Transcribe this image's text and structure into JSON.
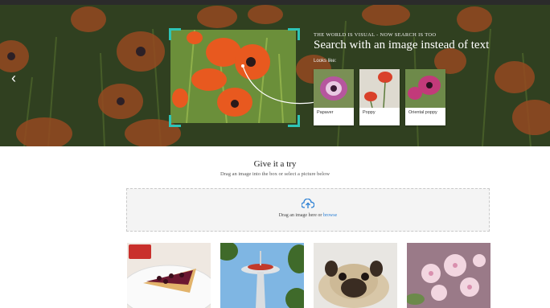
{
  "hero": {
    "eyebrow": "THE WORLD IS VISUAL - NOW SEARCH IS TOO",
    "headline": "Search with an image instead of text",
    "looks_like_label": "Looks like:",
    "results": [
      {
        "label": "Papaver"
      },
      {
        "label": "Poppy"
      },
      {
        "label": "Oriental poppy"
      }
    ],
    "prev_arrow": "‹"
  },
  "try": {
    "title": "Give it a try",
    "subtitle": "Drag an image into the box or select a picture below",
    "drop_text": "Drag an image here or",
    "browse_link": "browse"
  },
  "samples": [
    {
      "name": "dessert-tart"
    },
    {
      "name": "space-needle"
    },
    {
      "name": "pug-dog"
    },
    {
      "name": "cherry-blossom"
    }
  ],
  "colors": {
    "accent": "#2ec4b6",
    "link": "#2a7fd4",
    "poppy": "#e8591f"
  }
}
